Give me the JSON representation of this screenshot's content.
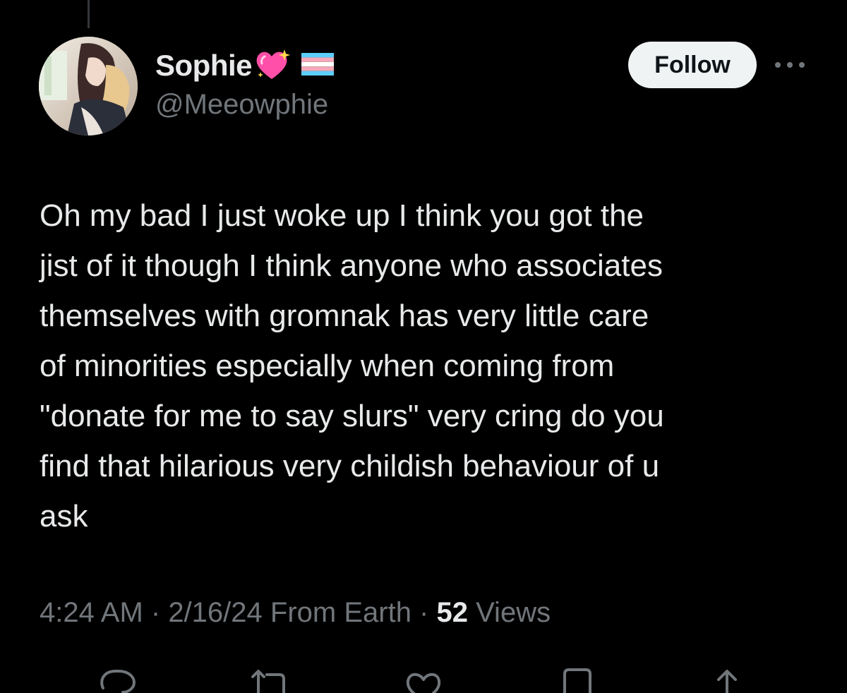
{
  "author": {
    "display_name": "Sophie",
    "handle": "@Meeowphie",
    "avatar": "avatar-image",
    "badges": [
      "sparkling-heart-icon",
      "transgender-flag-icon"
    ]
  },
  "follow_label": "Follow",
  "more_icon": "more-options-icon",
  "tweet": {
    "lines": [
      "Oh my bad I just woke up I think you got the",
      "jist of it though I think anyone who associates",
      "themselves with gromnak has very little care",
      "of minorities especially when coming from",
      "\"donate for me to say slurs\" very cring do you",
      "find that hilarious very childish behaviour of u",
      "ask"
    ]
  },
  "meta": {
    "time": "4:24 AM",
    "sep1": " · ",
    "date": "2/16/24",
    "source": " From Earth",
    "sep2": " · ",
    "views_count": "52",
    "views_label": " Views"
  },
  "actions": [
    "reply-icon",
    "retweet-icon",
    "like-icon",
    "bookmark-icon",
    "share-icon"
  ],
  "colors": {
    "background": "#000000",
    "text": "#e7e9ea",
    "secondary": "#71767b",
    "follow_bg": "#eff3f4",
    "heart": "#ff4fa8",
    "flag_blue": "#5bcefa",
    "flag_pink": "#f5a9b8"
  }
}
